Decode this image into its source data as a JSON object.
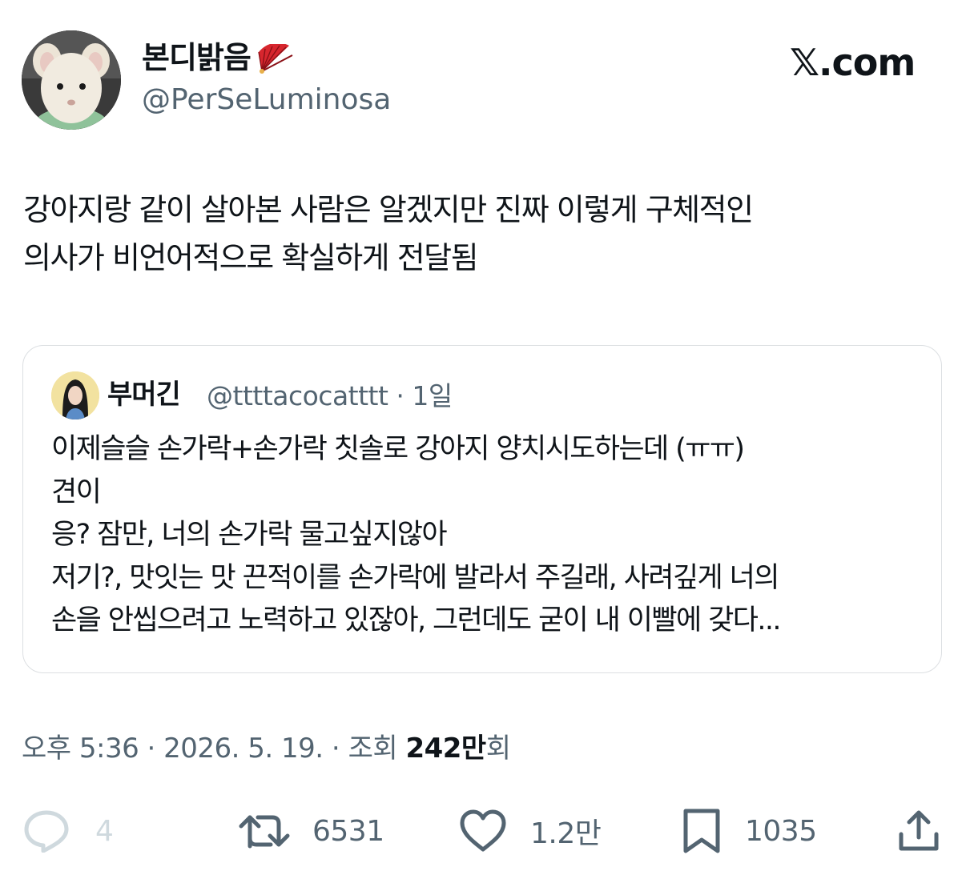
{
  "author": {
    "display_name": "본디밝음",
    "handle": "@PerSeLuminosa"
  },
  "brand": {
    "label": "𝕏.com"
  },
  "tweet": {
    "text": "강아지랑 같이 살아본 사람은 알겠지만 진짜 이렇게 구체적인\n의사가 비언어적으로 확실하게 전달됨"
  },
  "quote": {
    "display_name": "부머긴",
    "handle": "@ttttacocatttt",
    "time": "1일",
    "text": "이제슬슬 손가락+손가락 칫솔로 강아지 양치시도하는데 (ㅠㅠ)\n견이\n응? 잠만, 너의 손가락 물고싶지않아\n저기?, 맛잇는 맛 끈적이를 손가락에 발라서 주길래, 사려깊게 너의\n손을 안씹으려고 노력하고 있잖아, 그런데도 굳이 내 이빨에 갖다..."
  },
  "meta": {
    "time": "오후 5:36",
    "date": "2026. 5. 19.",
    "views_label": "조회",
    "views_count": "242만",
    "views_suffix": "회"
  },
  "actions": {
    "replies": "4",
    "retweets": "6531",
    "likes": "1.2만",
    "bookmarks": "1035"
  },
  "colors": {
    "text": "#0f1419",
    "secondary": "#536471",
    "border": "#dcdfe2",
    "muted": "#cfd9de"
  },
  "icons": [
    "fan-icon",
    "reply-icon",
    "retweet-icon",
    "like-icon",
    "bookmark-icon",
    "share-icon"
  ]
}
